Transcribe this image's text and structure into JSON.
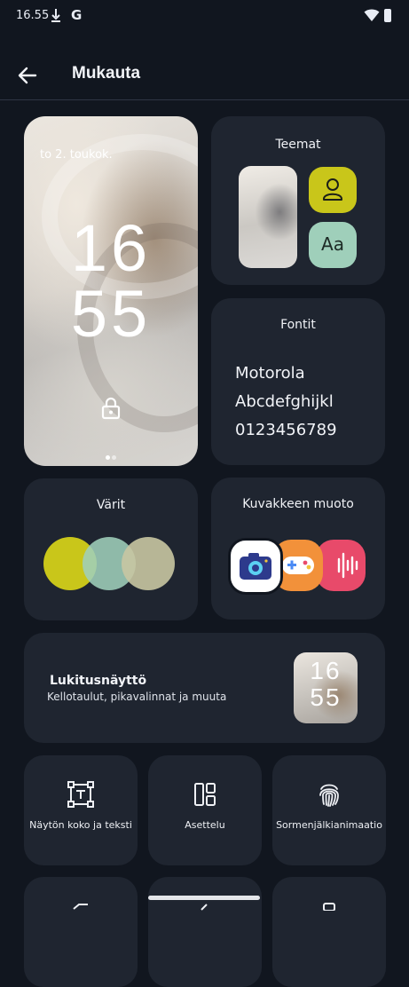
{
  "status_bar": {
    "time": "16.55",
    "g_icon": "G"
  },
  "app_bar": {
    "title": "Mukauta"
  },
  "lock_preview": {
    "date": "to 2. toukok.",
    "clock_hour": "16",
    "clock_min": "55"
  },
  "themes": {
    "title": "Teemat",
    "font_button": "Aa"
  },
  "fonts": {
    "title": "Fontit",
    "samples": [
      "Motorola",
      "Abcdefghijkl",
      "0123456789"
    ]
  },
  "colors": {
    "title": "Värit",
    "swatches": [
      "#c9c61a",
      "#9fcfba",
      "#c8c7a2"
    ]
  },
  "icon_shape": {
    "title": "Kuvakkeen muoto"
  },
  "lockscreen": {
    "title": "Lukitusnäyttö",
    "subtitle": "Kellotaulut, pikavalinnat ja muuta",
    "clock_hour": "16",
    "clock_min": "55"
  },
  "tiles": [
    {
      "label": "Näytön koko ja teksti"
    },
    {
      "label": "Asettelu"
    },
    {
      "label": "Sormenjälkianimaatio"
    }
  ]
}
